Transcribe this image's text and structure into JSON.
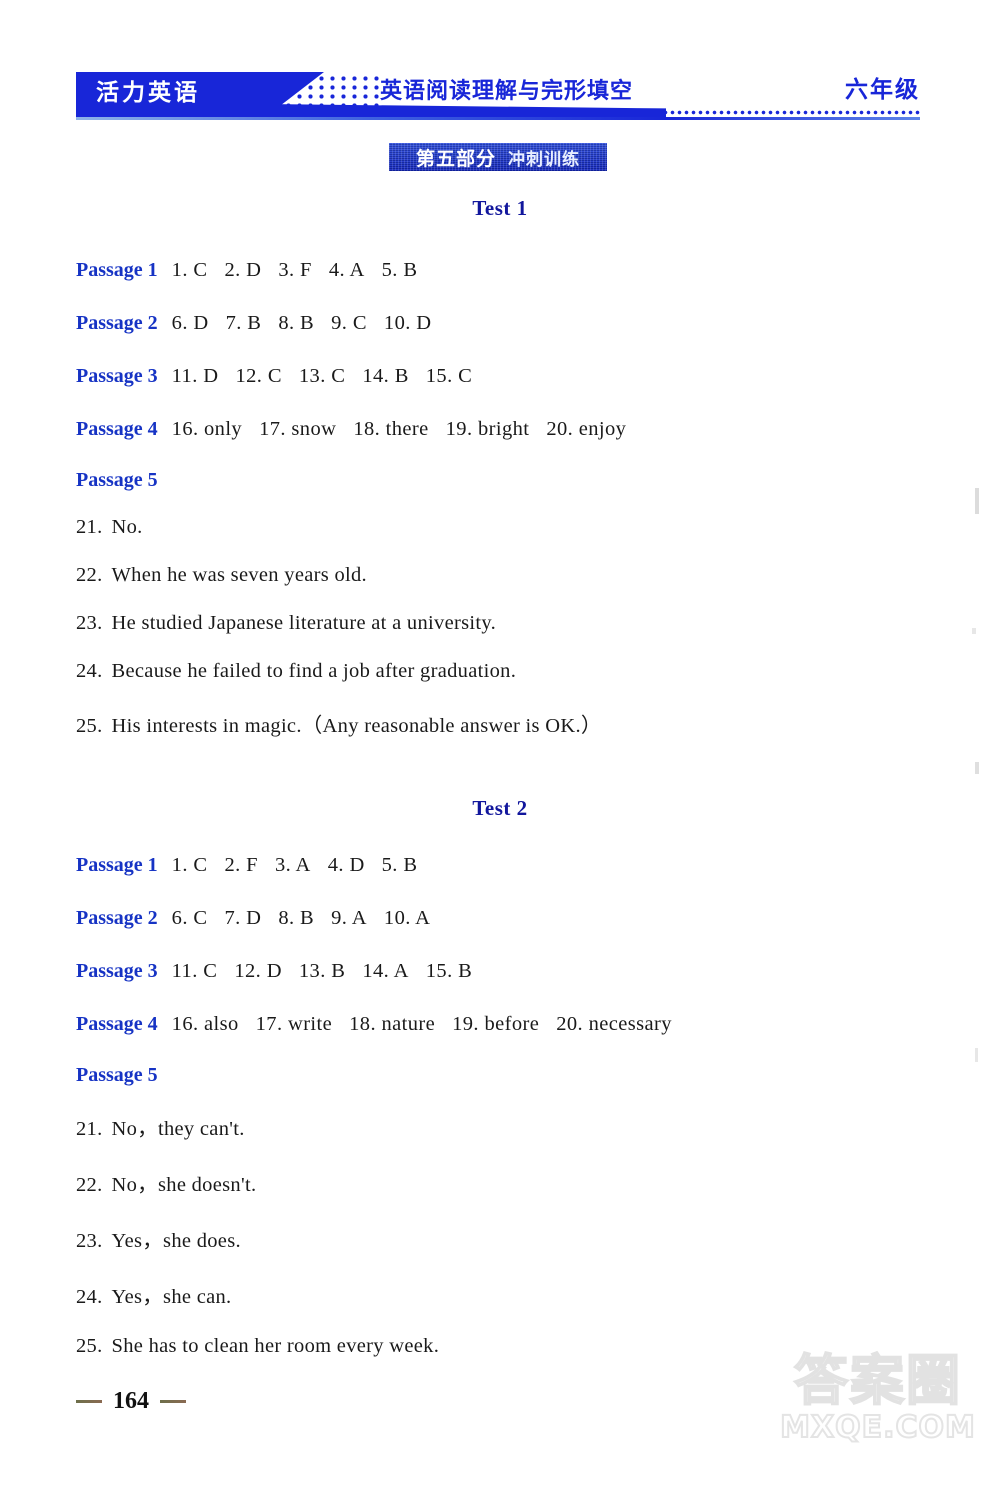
{
  "header": {
    "series_name": "活力英语",
    "book_title": "英语阅读理解与完形填空",
    "grade": "六年级"
  },
  "section_banner": {
    "part_label": "第五部分",
    "part_subtitle": "冲刺训练"
  },
  "tests": [
    {
      "heading": "Test 1",
      "passages": [
        {
          "label": "Passage 1",
          "answers": [
            "1. C",
            "2. D",
            "3. F",
            "4. A",
            "5. B"
          ]
        },
        {
          "label": "Passage 2",
          "answers": [
            "6. D",
            "7. B",
            "8. B",
            "9. C",
            "10. D"
          ]
        },
        {
          "label": "Passage 3",
          "answers": [
            "11. D",
            "12. C",
            "13. C",
            "14. B",
            "15. C"
          ]
        },
        {
          "label": "Passage 4",
          "answers": [
            "16. only",
            "17. snow",
            "18. there",
            "19. bright",
            "20. enjoy"
          ]
        }
      ],
      "passage5": {
        "label": "Passage 5",
        "items": [
          {
            "number": "21.",
            "text": "No."
          },
          {
            "number": "22.",
            "text": "When he was seven years old."
          },
          {
            "number": "23.",
            "text": "He studied Japanese literature at a university."
          },
          {
            "number": "24.",
            "text": "Because he failed to find a job after graduation."
          },
          {
            "number": "25.",
            "text": "His interests in magic.（Any reasonable answer is OK.）"
          }
        ]
      }
    },
    {
      "heading": "Test 2",
      "passages": [
        {
          "label": "Passage 1",
          "answers": [
            "1. C",
            "2. F",
            "3. A",
            "4. D",
            "5. B"
          ]
        },
        {
          "label": "Passage 2",
          "answers": [
            "6. C",
            "7. D",
            "8. B",
            "9. A",
            "10. A"
          ]
        },
        {
          "label": "Passage 3",
          "answers": [
            "11. C",
            "12. D",
            "13. B",
            "14. A",
            "15. B"
          ]
        },
        {
          "label": "Passage 4",
          "answers": [
            "16. also",
            "17. write",
            "18. nature",
            "19. before",
            "20. necessary"
          ]
        }
      ],
      "passage5": {
        "label": "Passage 5",
        "items": [
          {
            "number": "21.",
            "text": "No，they can't."
          },
          {
            "number": "22.",
            "text": "No，she doesn't."
          },
          {
            "number": "23.",
            "text": "Yes，she does."
          },
          {
            "number": "24.",
            "text": "Yes，she can."
          },
          {
            "number": "25.",
            "text": "She has to clean her room every week."
          }
        ]
      }
    }
  ],
  "footer": {
    "page_number": "164"
  },
  "watermark": {
    "chinese": "答案圈",
    "site": "MXQE.COM"
  },
  "colors": {
    "brand_blue": "#1826d8",
    "label_blue": "#1633c4",
    "heading_blue": "#11169c"
  }
}
